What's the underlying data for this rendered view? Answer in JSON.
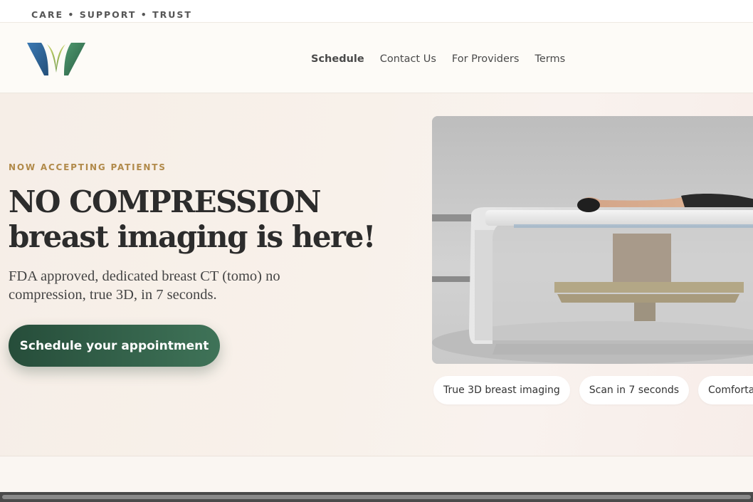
{
  "topbar": {
    "tagline": "CARE • SUPPORT • TRUST"
  },
  "header": {
    "nav": [
      {
        "label": "Schedule",
        "active": true
      },
      {
        "label": "Contact Us",
        "active": false
      },
      {
        "label": "For Providers",
        "active": false
      },
      {
        "label": "Terms",
        "active": false
      }
    ]
  },
  "hero": {
    "eyebrow": "NOW ACCEPTING PATIENTS",
    "headline_line1": "NO COMPRESSION",
    "headline_line2": "breast imaging is here!",
    "subtext": "FDA approved, dedicated breast CT (tomo) no compression, true 3D, in 7 seconds.",
    "cta_label": "Schedule your appointment",
    "chips": [
      "True 3D breast imaging",
      "Scan in 7 seconds",
      "Comfortable"
    ]
  },
  "colors": {
    "accent_gold": "#b18a4a",
    "cta_green_start": "#264d3a",
    "cta_green_end": "#3f7358",
    "logo_blue": "#2f5f8e",
    "logo_green": "#3a7a5a"
  },
  "icons": {
    "logo": "leaf-w-logo"
  }
}
